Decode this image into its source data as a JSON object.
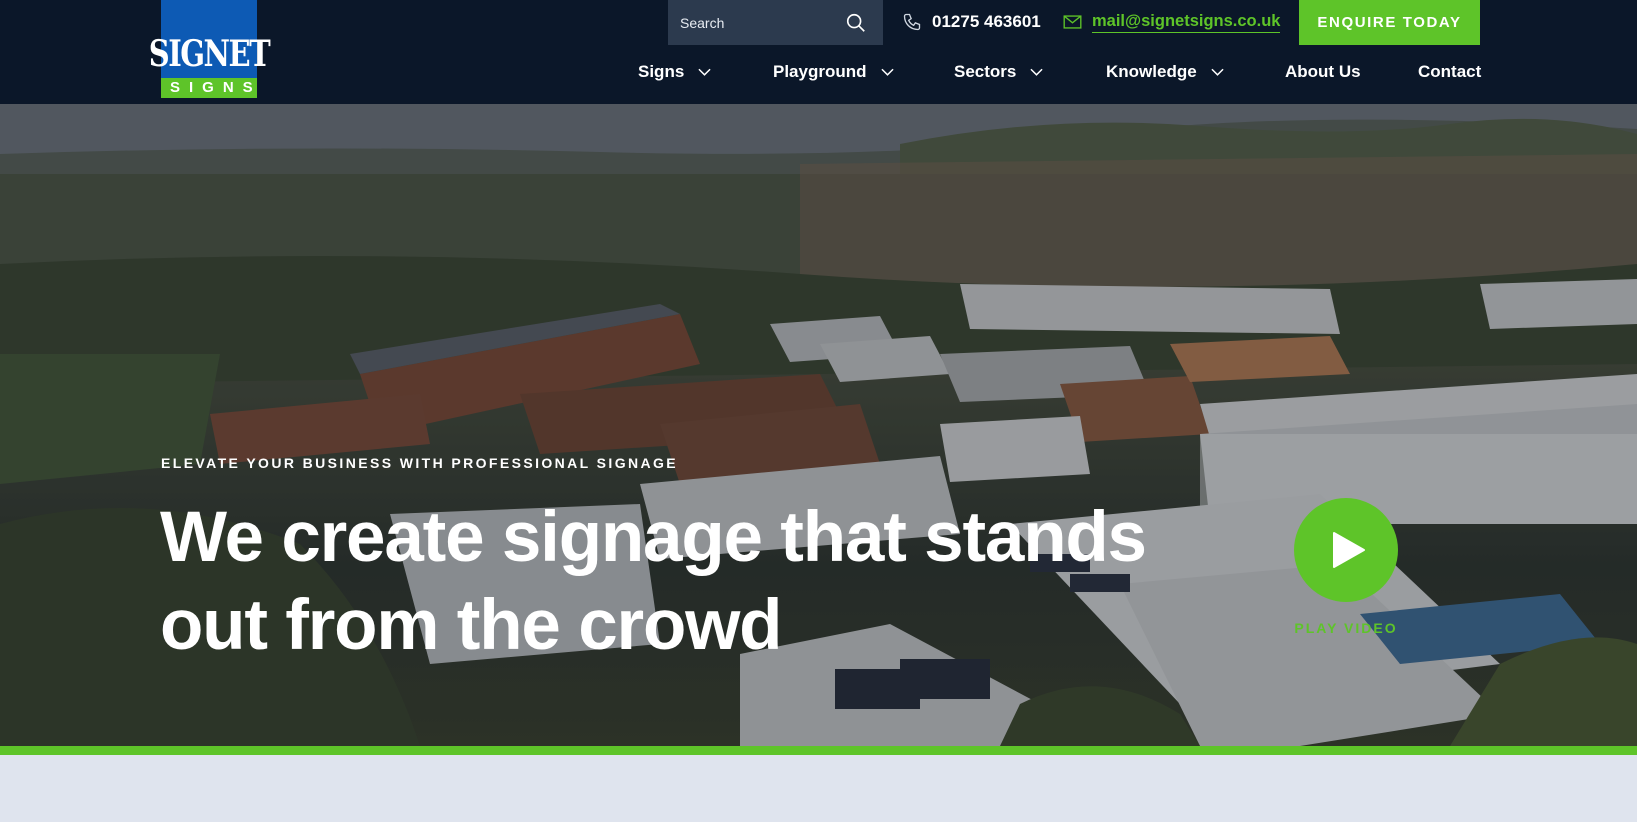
{
  "brand": {
    "logo_word": "SIGNET",
    "logo_sub": "SIGNS",
    "colors": {
      "navy": "#0b1729",
      "blue": "#0d5ab4",
      "green": "#5ec429"
    }
  },
  "header": {
    "search_placeholder": "Search",
    "phone": "01275 463601",
    "email": "mail@signetsigns.co.uk",
    "cta": "ENQUIRE TODAY"
  },
  "nav": {
    "items": [
      {
        "label": "Signs",
        "dropdown": true
      },
      {
        "label": "Playground",
        "dropdown": true
      },
      {
        "label": "Sectors",
        "dropdown": true
      },
      {
        "label": "Knowledge",
        "dropdown": true
      },
      {
        "label": "About Us",
        "dropdown": false
      },
      {
        "label": "Contact",
        "dropdown": false
      }
    ]
  },
  "hero": {
    "eyebrow": "ELEVATE YOUR BUSINESS WITH PROFESSIONAL SIGNAGE",
    "headline_line1": "We create signage that stands",
    "headline_line2": "out from the crowd",
    "play_label": "PLAY VIDEO"
  },
  "icons": [
    "search-icon",
    "phone-icon",
    "mail-icon",
    "chevron-down-icon",
    "play-icon"
  ]
}
